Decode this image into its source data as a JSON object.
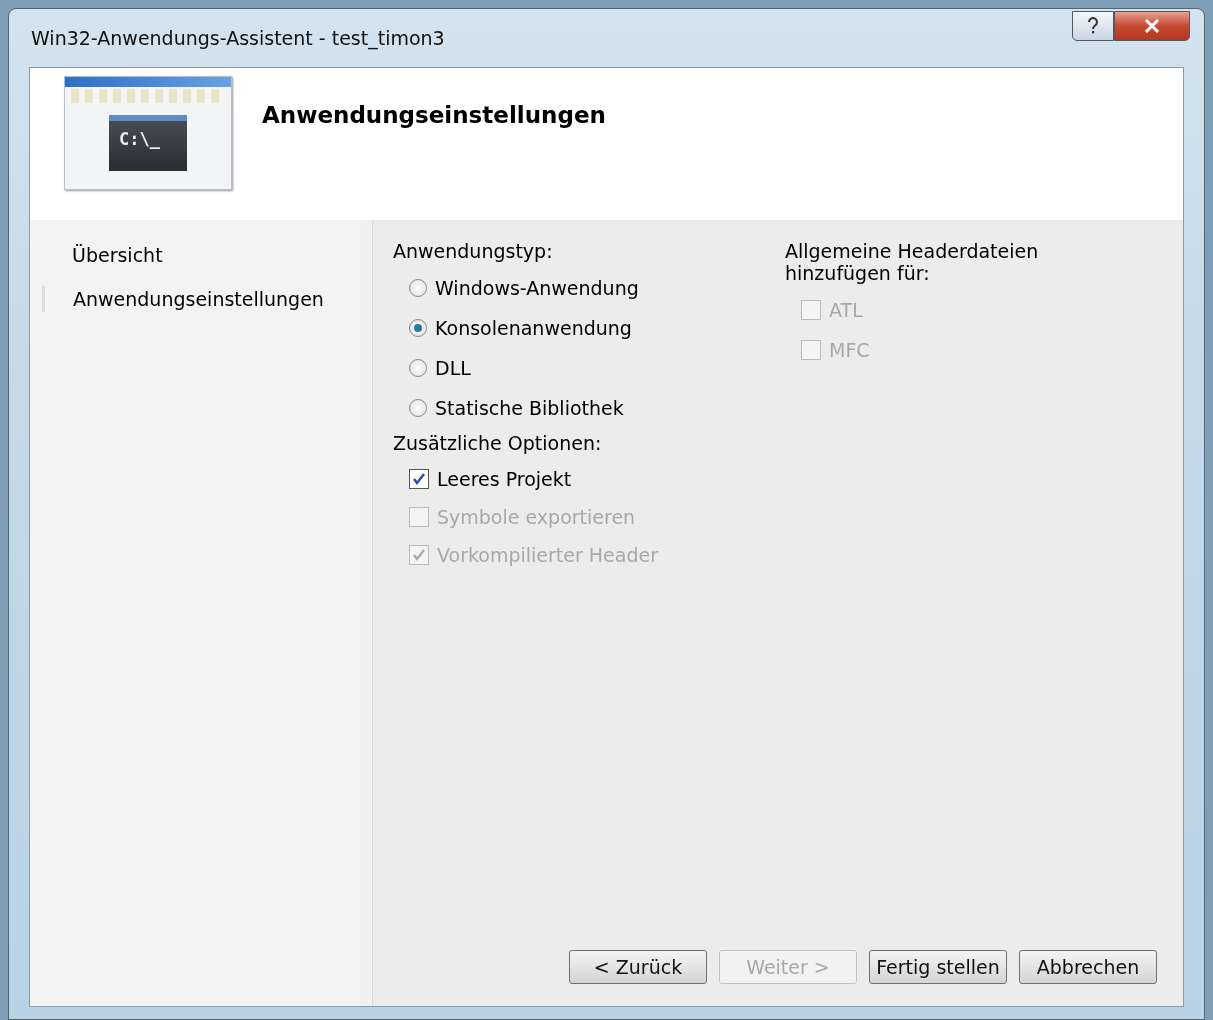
{
  "window": {
    "title": "Win32-Anwendungs-Assistent - test_timon3"
  },
  "header": {
    "title": "Anwendungseinstellungen",
    "illustration_text": "C:\\_"
  },
  "sidebar": {
    "items": [
      {
        "label": "Übersicht",
        "selected": false
      },
      {
        "label": "Anwendungseinstellungen",
        "selected": true
      }
    ]
  },
  "application_type": {
    "label": "Anwendungstyp:",
    "options": [
      {
        "label": "Windows-Anwendung",
        "selected": false,
        "disabled": false
      },
      {
        "label": "Konsolenanwendung",
        "selected": true,
        "disabled": false
      },
      {
        "label": "DLL",
        "selected": false,
        "disabled": false
      },
      {
        "label": "Statische Bibliothek",
        "selected": false,
        "disabled": false
      }
    ]
  },
  "additional_options": {
    "label": "Zusätzliche Optionen:",
    "options": [
      {
        "label": "Leeres Projekt",
        "checked": true,
        "disabled": false
      },
      {
        "label": "Symbole exportieren",
        "checked": false,
        "disabled": true
      },
      {
        "label": "Vorkompilierter Header",
        "checked": true,
        "disabled": true
      }
    ]
  },
  "common_headers": {
    "label": "Allgemeine Headerdateien hinzufügen für:",
    "options": [
      {
        "label": "ATL",
        "checked": false,
        "disabled": true
      },
      {
        "label": "MFC",
        "checked": false,
        "disabled": true
      }
    ]
  },
  "buttons": [
    {
      "label": "< Zurück",
      "disabled": false
    },
    {
      "label": "Weiter >",
      "disabled": true
    },
    {
      "label": "Fertig stellen",
      "disabled": false
    },
    {
      "label": "Abbrechen",
      "disabled": false
    }
  ]
}
